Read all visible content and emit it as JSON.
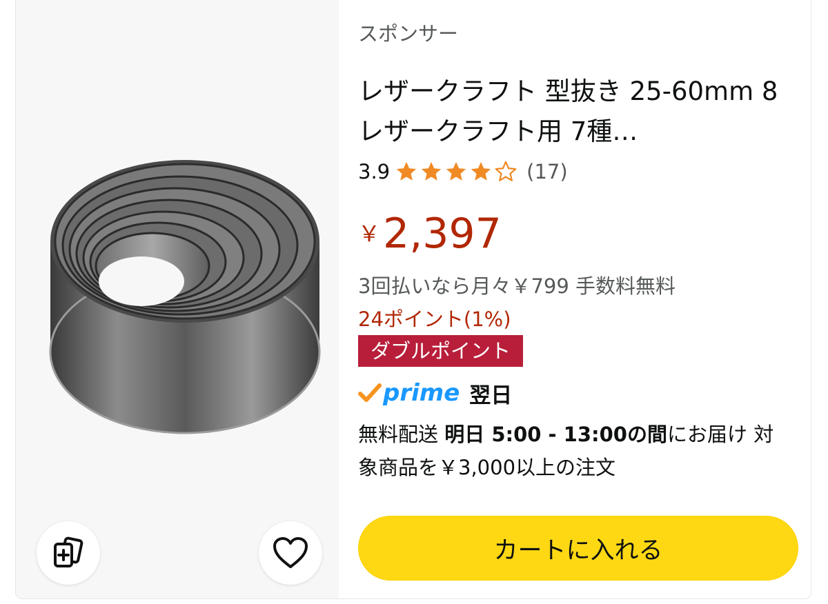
{
  "listing": {
    "sponsored_label": "スポンサー",
    "title": "レザークラフト 型抜き 25-60mm 8レザークラフト用 7種…",
    "rating": {
      "value": "3.9",
      "stars_out_of_5": 3.9,
      "review_count": "(17)"
    },
    "price": {
      "symbol": "￥",
      "amount": "2,397"
    },
    "installment_text": "3回払いなら月々￥799 手数料無料",
    "points_text": "24ポイント(1%)",
    "badge_text": "ダブルポイント",
    "prime": {
      "logo_text": "prime",
      "delivery_speed": "翌日"
    },
    "delivery": {
      "prefix": "無料配送 ",
      "window": "明日 5:00 - 13:00の間",
      "suffix": "にお届け 対象商品を￥3,000以上の注文"
    },
    "cart_button_label": "カートに入れる"
  },
  "colors": {
    "price_red": "#b12704",
    "badge_red": "#b81e3a",
    "star_orange": "#f08a24",
    "prime_blue": "#1a98ff",
    "prime_check_orange": "#f7931e",
    "cart_yellow": "#ffd814"
  },
  "icons": {
    "compare": "compare-cards-icon",
    "wishlist": "heart-outline-icon"
  }
}
